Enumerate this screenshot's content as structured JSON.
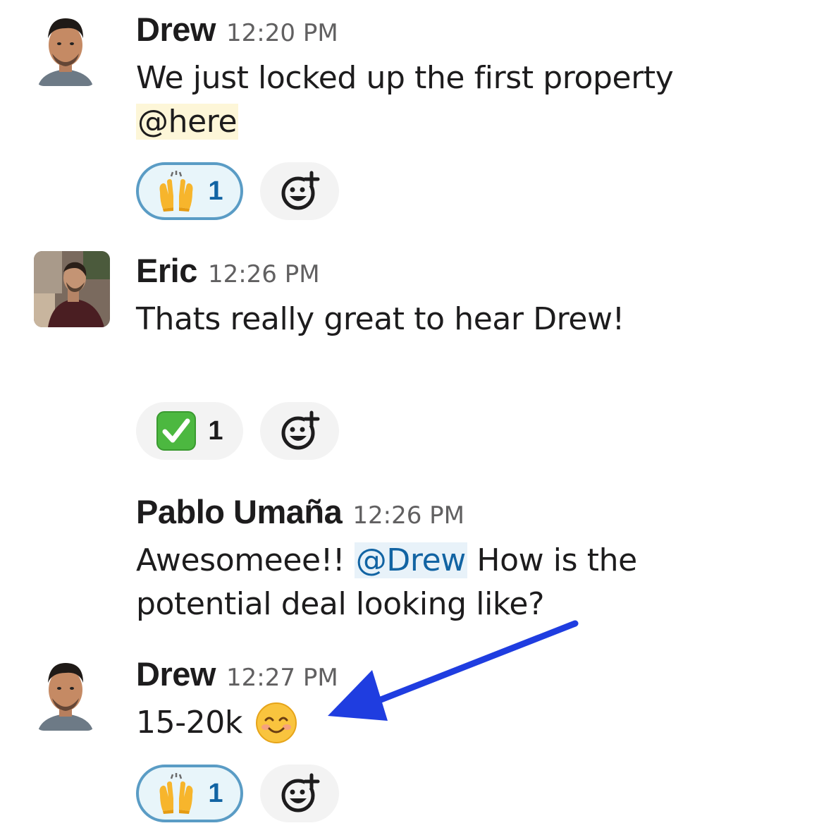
{
  "messages": [
    {
      "author": "Drew",
      "time": "12:20 PM",
      "line1": "We just locked up the first property",
      "mention": "@here",
      "reactions": [
        {
          "emoji": "raised-hands",
          "count": "1",
          "mine": true
        }
      ]
    },
    {
      "author": "Eric",
      "time": "12:26 PM",
      "line1": "Thats really great to hear Drew!",
      "reactions": [
        {
          "emoji": "white-check-mark",
          "count": "1",
          "mine": false
        }
      ]
    },
    {
      "author": "Pablo Umaña",
      "time": "12:26 PM",
      "line1_pre": "Awesomeee!! ",
      "mention": "@Drew",
      "line1_post": " How is the",
      "line2": "potential deal looking like?"
    },
    {
      "author": "Drew",
      "time": "12:27 PM",
      "line1": "15-20k",
      "inline_emoji": "smiling-face",
      "reactions": [
        {
          "emoji": "raised-hands",
          "count": "1",
          "mine": true
        }
      ]
    }
  ],
  "add_reaction_icon": "add-reaction-icon",
  "annotation": {
    "icon": "arrow-icon",
    "color": "#1f3de0"
  },
  "colors": {
    "mention_here_bg": "#fdf6d8",
    "mention_user": "#1264a3",
    "reaction_border": "#5a9cc5"
  }
}
